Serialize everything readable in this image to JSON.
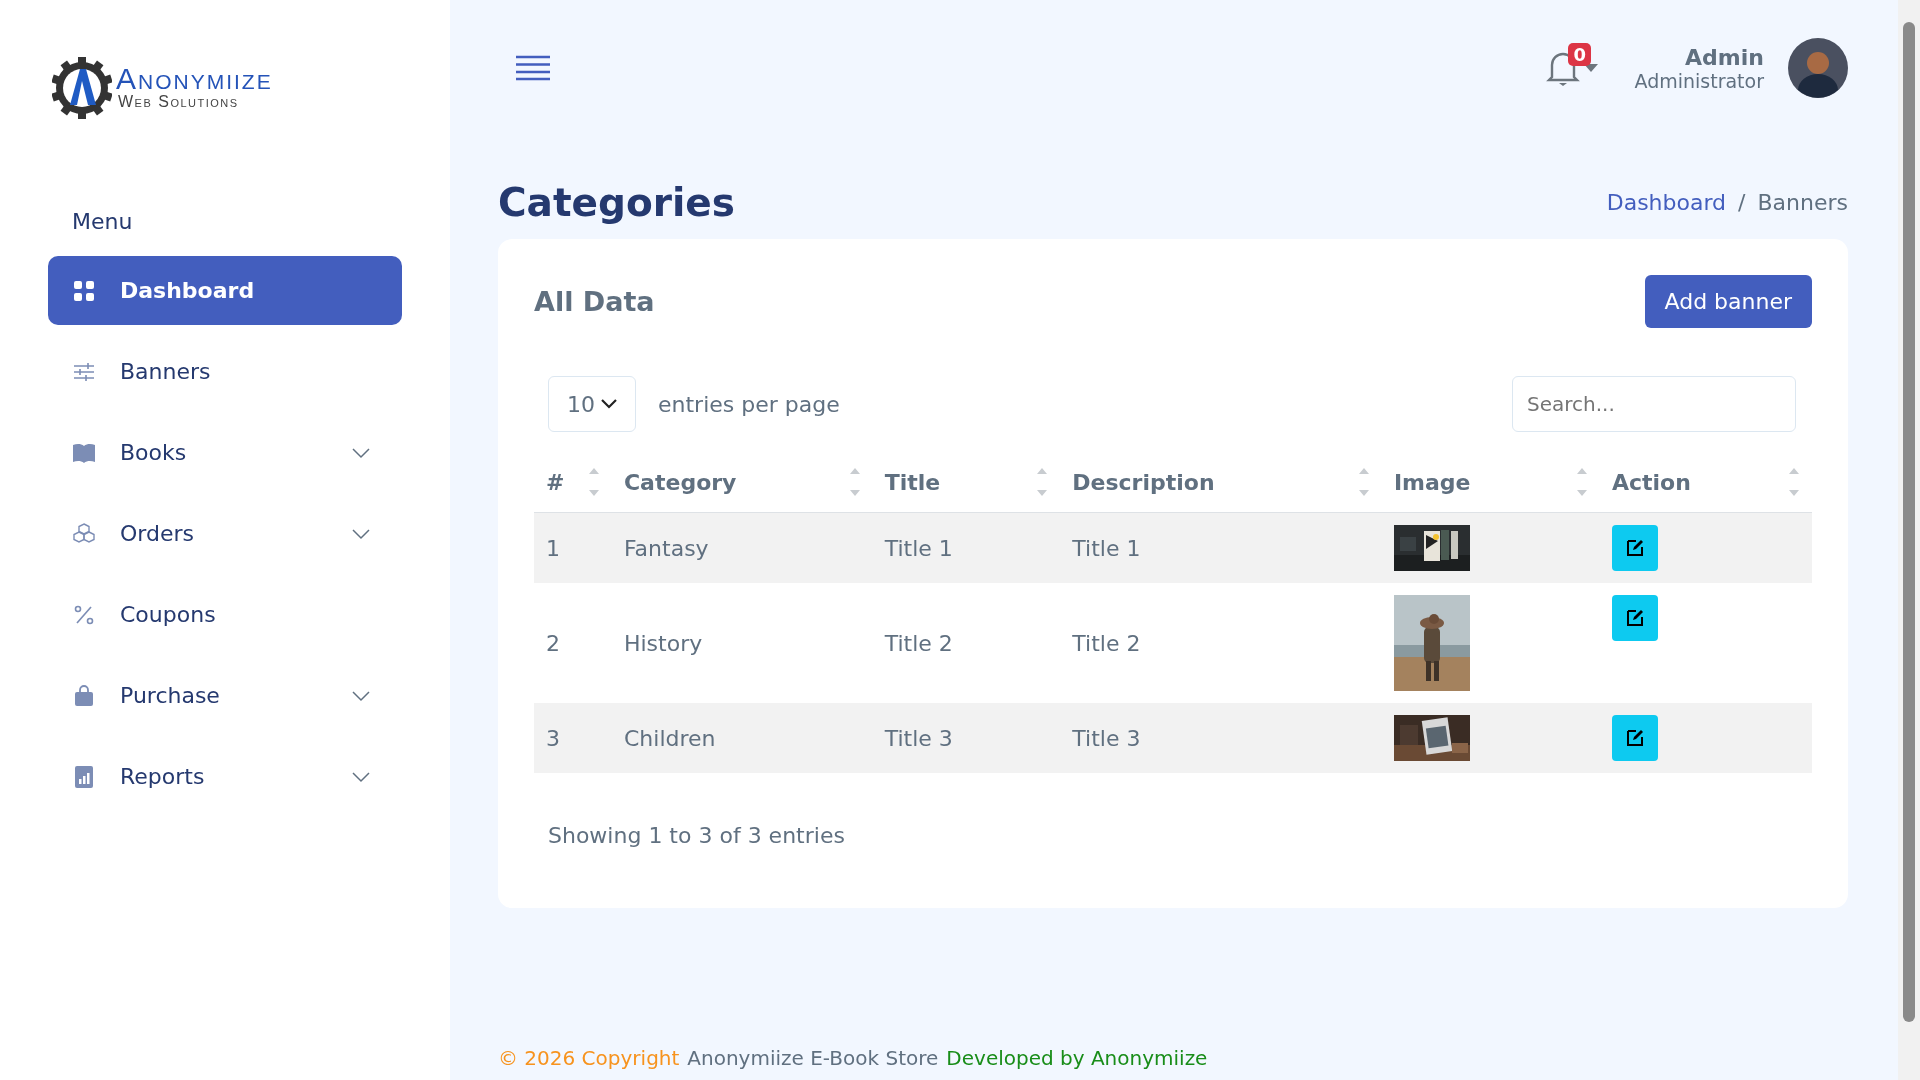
{
  "logo": {
    "name": "Anonymiize",
    "tagline": "Web Solutions"
  },
  "sidebar": {
    "menu_title": "Menu",
    "items": [
      {
        "label": "Dashboard",
        "selected": true,
        "has_submenu": false
      },
      {
        "label": "Banners",
        "selected": false,
        "has_submenu": false
      },
      {
        "label": "Books",
        "selected": false,
        "has_submenu": true
      },
      {
        "label": "Orders",
        "selected": false,
        "has_submenu": true
      },
      {
        "label": "Coupons",
        "selected": false,
        "has_submenu": false
      },
      {
        "label": "Purchase",
        "selected": false,
        "has_submenu": true
      },
      {
        "label": "Reports",
        "selected": false,
        "has_submenu": true
      }
    ]
  },
  "header": {
    "notification_count": "0",
    "user_name": "Admin",
    "user_role": "Administrator"
  },
  "page": {
    "title": "Categories",
    "breadcrumb_separator": "/",
    "breadcrumb": [
      {
        "label": "Dashboard",
        "current": false
      },
      {
        "label": "Banners",
        "current": true
      }
    ]
  },
  "card": {
    "title": "All Data",
    "add_button": "Add banner",
    "page_size": "10",
    "entries_label": "entries per page",
    "search": {
      "placeholder": "Search..."
    },
    "table": {
      "columns": [
        "#",
        "Category",
        "Title",
        "Description",
        "Image",
        "Action"
      ],
      "rows": [
        {
          "cells": [
            "1",
            "Fantasy",
            "Title 1",
            "Title 1"
          ]
        },
        {
          "cells": [
            "2",
            "History",
            "Title 2",
            "Title 2"
          ]
        },
        {
          "cells": [
            "3",
            "Children",
            "Title 3",
            "Title 3"
          ]
        }
      ]
    },
    "info": "Showing 1 to 3 of 3 entries"
  },
  "footer": {
    "copyright": "© 2026 Copyright",
    "store": "Anonymiize E-Book Store",
    "credit": "Developed by Anonymiize"
  }
}
